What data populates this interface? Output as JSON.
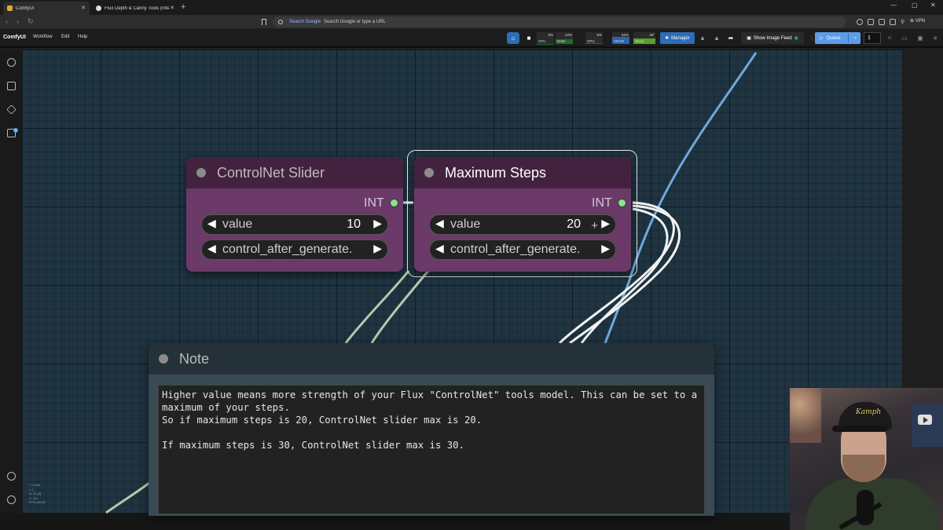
{
  "browser": {
    "tabs": [
      {
        "title": "ComfyUI",
        "active": true
      },
      {
        "title": "Flux Depth & Canny Tools (Integrat…",
        "active": false
      }
    ],
    "address_placeholder": "Search Google or type a URL",
    "search_engine_label": "Search Google",
    "vpn_label": "VPN"
  },
  "menubar": {
    "brand": "ComfyUI",
    "items": [
      "Workflow",
      "Edit",
      "Help"
    ],
    "stats": [
      {
        "label": "CPU",
        "value": "3%",
        "level": 0.03
      },
      {
        "label": "RAM",
        "value": "42%",
        "level": 0.42
      },
      {
        "label": "GPU",
        "value": "6%",
        "level": 0.06
      },
      {
        "label": "VRAM",
        "value": "62%",
        "level": 0.62
      },
      {
        "label": "Temp",
        "value": "49°",
        "level": 0.49
      }
    ],
    "manager_label": "Manager",
    "image_feed_label": "Show Image Feed",
    "queue_label": "Queue",
    "queue_count": "1",
    "accent_color": "#5e9be8"
  },
  "nodes": {
    "controlnet_slider": {
      "title": "ControlNet Slider",
      "output_type": "INT",
      "value_name": "value",
      "value": "10",
      "control_name": "control_after_generate."
    },
    "maximum_steps": {
      "title": "Maximum Steps",
      "output_type": "INT",
      "value_name": "value",
      "value": "20",
      "control_name": "control_after_generate."
    }
  },
  "note": {
    "title": "Note",
    "text": "Higher value means more strength of your Flux \"ControlNet\" tools model. This can be set to a\nmaximum of your steps.\nSo if maximum steps is 20, ControlNet slider max is 20.\n\nIf maximum steps is 30, ControlNet slider max is 30."
  },
  "canvas_stats": "T: 0.00s\nI: 0\nN: 31 [4]\nV: 201\nFPS:165.83",
  "webcam": {
    "cap_logo": "Kamph"
  }
}
